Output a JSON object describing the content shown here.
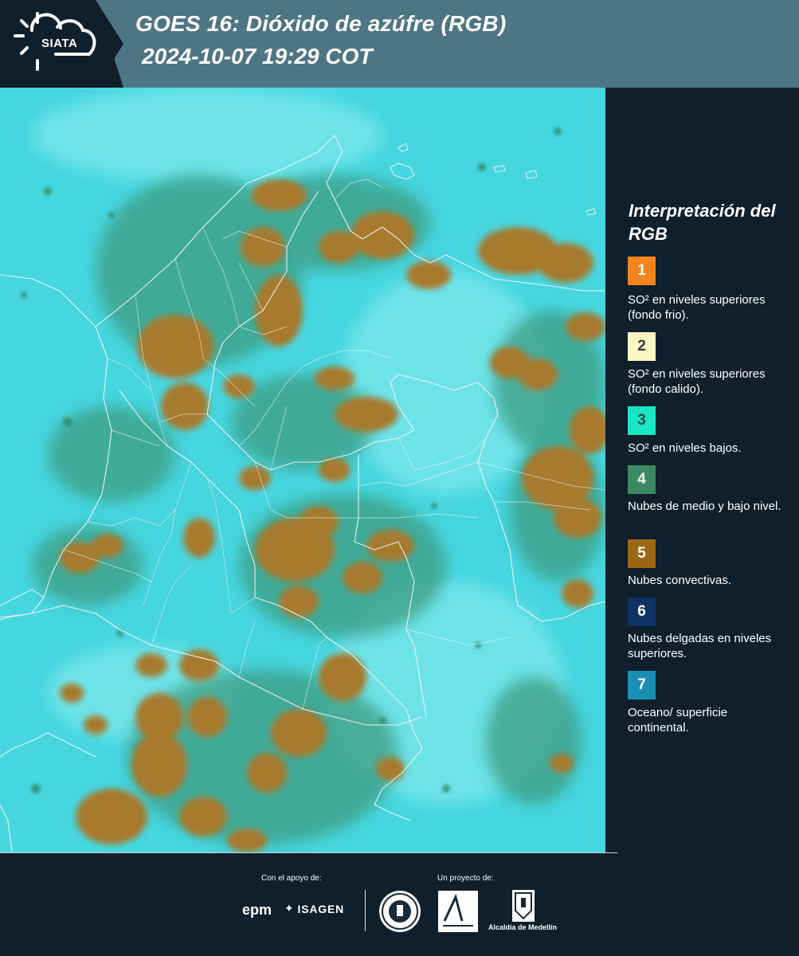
{
  "header": {
    "logo_text": "SIATA",
    "title_line1": "GOES 16: Dióxido de azúfre (RGB)",
    "title_line2": "2024-10-07 19:29 COT"
  },
  "legend": {
    "title": "Interpretación del RGB",
    "items": [
      {
        "number": "1",
        "label": "SO² en niveles superiores (fondo frio).",
        "color": "#f5841f",
        "text_color": "#ffffff"
      },
      {
        "number": "2",
        "label": "SO² en niveles superiores (fondo calido).",
        "color": "#fdf6c3",
        "text_color": "#3a3a3a"
      },
      {
        "number": "3",
        "label": "SO² en niveles bajos.",
        "color": "#19e6c4",
        "text_color": "#2a4a44"
      },
      {
        "number": "4",
        "label": "Nubes de medio y bajo nivel.",
        "color": "#3b8a62",
        "text_color": "#ffffff"
      },
      {
        "number": "5",
        "label": "Nubes convectivas.",
        "color": "#9c6714",
        "text_color": "#ffffff"
      },
      {
        "number": "6",
        "label": "Nubes delgadas en niveles superiores.",
        "color": "#0f3264",
        "text_color": "#ffffff"
      },
      {
        "number": "7",
        "label": "Oceano/ superficie continental.",
        "color": "#1a8fb4",
        "text_color": "#ffffff"
      }
    ]
  },
  "footer": {
    "support_label": "Con el apoyo de:",
    "project_label": "Un proyecto de:",
    "epm": "epm",
    "isagen": "ISAGEN",
    "alcaldia": "Alcaldía de Medellín"
  },
  "colors": {
    "background": "#0f1f2b",
    "header_band": "#4e7584",
    "map_base": "#42d3de",
    "convective": "#a5772c",
    "low_cloud": "#3f9a7e"
  }
}
